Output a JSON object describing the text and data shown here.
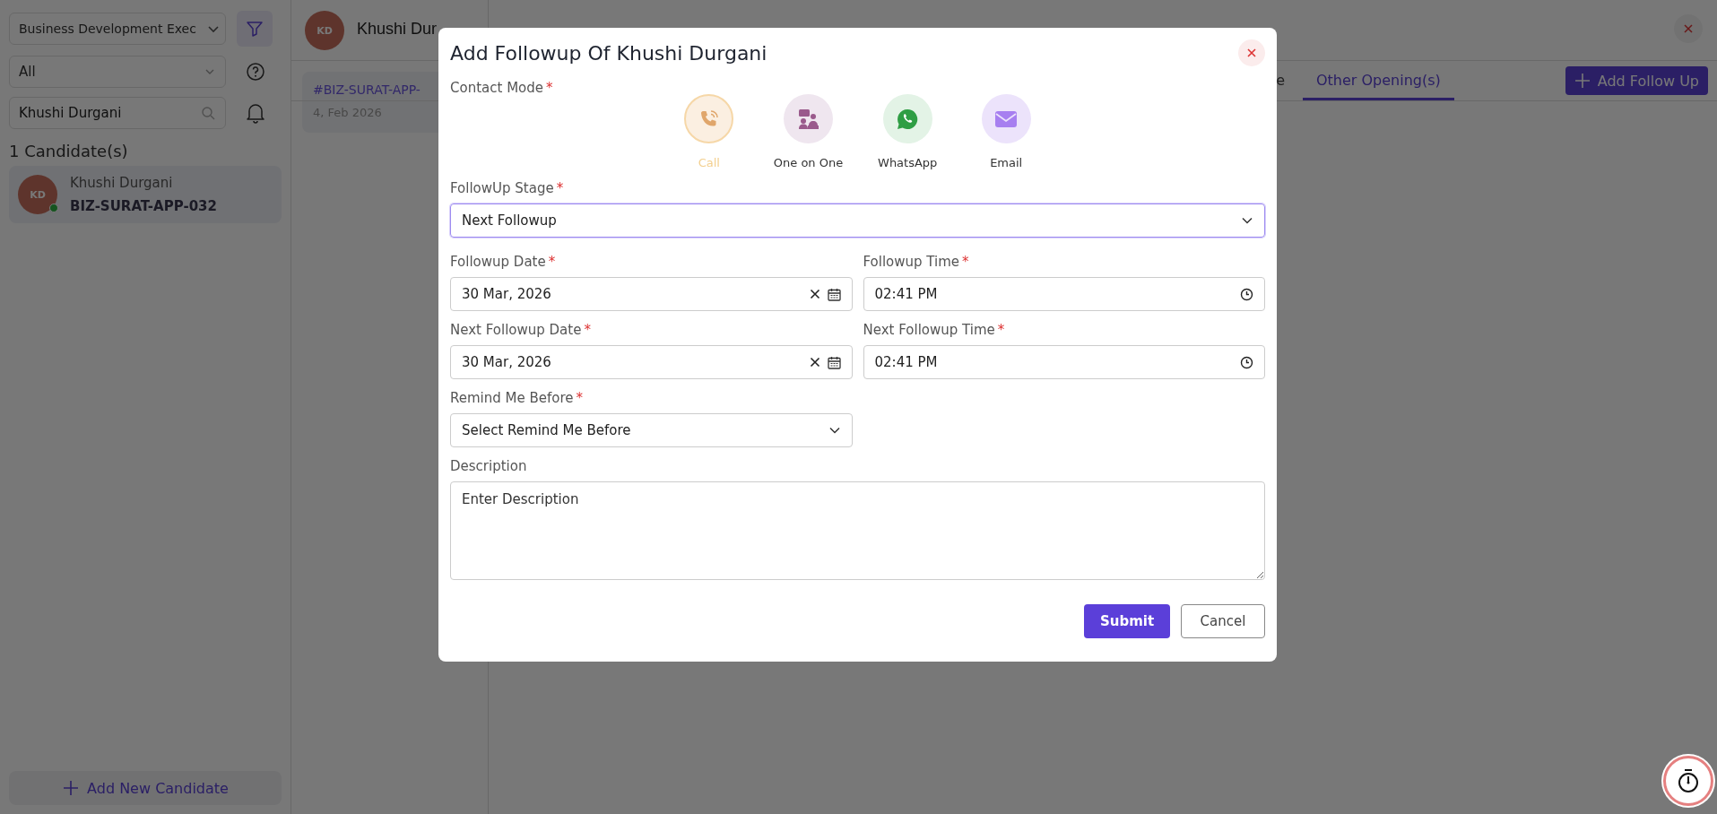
{
  "sidebar": {
    "role_select": "Business Development Exec",
    "status_select": "All",
    "search": {
      "value": "Khushi Durgani"
    },
    "count": "1 Candidate(s)",
    "candidates": [
      {
        "initials": "KD",
        "name": "Khushi Durgani",
        "code": "BIZ-SURAT-APP-032",
        "online": true
      }
    ],
    "add_button": "Add New Candidate"
  },
  "header": {
    "initials": "KD",
    "name": "Khushi Dur"
  },
  "application_card": {
    "code": "#BIZ-SURAT-APP-",
    "date": "4, Feb 2026"
  },
  "tabs": [
    {
      "label": "e",
      "selected": false
    },
    {
      "label": "Other Opening(s)",
      "selected": true
    }
  ],
  "add_follow_up_button": "Add Follow Up",
  "modal": {
    "title": "Add Followup Of Khushi Durgani",
    "required_marker": "*",
    "contact_mode": {
      "label": "Contact Mode",
      "required": true
    },
    "contact_modes": [
      {
        "kind": "call",
        "label": "Call",
        "selected": true
      },
      {
        "kind": "meeting",
        "label": "One on One",
        "selected": false
      },
      {
        "kind": "whatsapp",
        "label": "WhatsApp",
        "selected": false
      },
      {
        "kind": "email",
        "label": "Email",
        "selected": false
      }
    ],
    "stage": {
      "label": "FollowUp Stage",
      "required": true,
      "value": "Next Followup"
    },
    "fields": [
      {
        "kind": "date",
        "label": "Followup Date",
        "required": true,
        "value": "30 Mar, 2026"
      },
      {
        "kind": "time",
        "label": "Followup Time",
        "required": true,
        "value": "02:41 PM"
      },
      {
        "kind": "date",
        "label": "Next Followup Date",
        "required": true,
        "value": "30 Mar, 2026"
      },
      {
        "kind": "time",
        "label": "Next Followup Time",
        "required": true,
        "value": "02:41 PM"
      },
      {
        "kind": "select",
        "label": "Remind Me Before",
        "required": true,
        "value": "Select Remind Me Before"
      }
    ],
    "description": {
      "label": "Description",
      "placeholder": "Enter Description"
    },
    "submit": "Submit",
    "cancel": "Cancel"
  }
}
